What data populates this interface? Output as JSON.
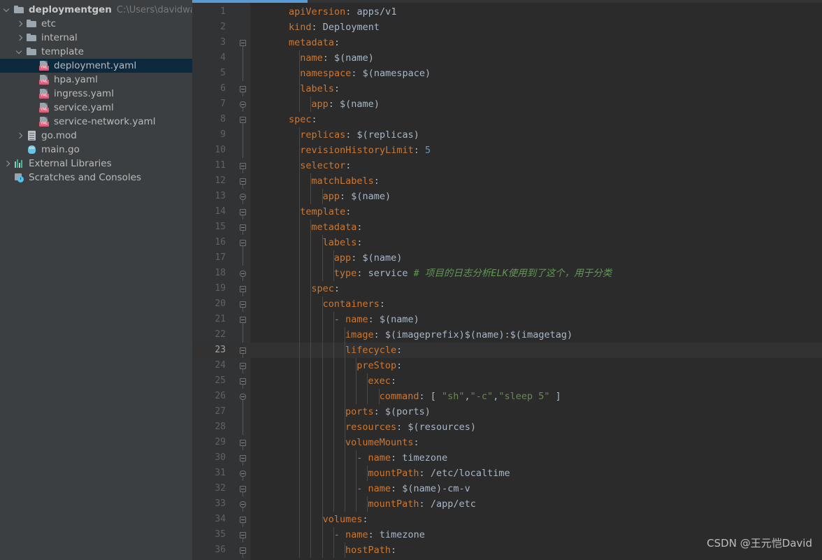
{
  "project": {
    "root": {
      "label": "deploymentgen",
      "path": "C:\\Users\\davidwang.SC",
      "icon": "folder-icon",
      "expanded": true
    },
    "items": [
      {
        "label": "etc",
        "icon": "folder-icon",
        "depth": 1,
        "chevron": "collapsed",
        "selected": false
      },
      {
        "label": "internal",
        "icon": "folder-icon",
        "depth": 1,
        "chevron": "collapsed",
        "selected": false
      },
      {
        "label": "template",
        "icon": "folder-icon",
        "depth": 1,
        "chevron": "expanded",
        "selected": false
      },
      {
        "label": "deployment.yaml",
        "icon": "yaml-file-icon",
        "depth": 2,
        "chevron": "none",
        "selected": true
      },
      {
        "label": "hpa.yaml",
        "icon": "yaml-file-icon",
        "depth": 2,
        "chevron": "none",
        "selected": false
      },
      {
        "label": "ingress.yaml",
        "icon": "yaml-file-icon",
        "depth": 2,
        "chevron": "none",
        "selected": false
      },
      {
        "label": "service.yaml",
        "icon": "yaml-file-icon",
        "depth": 2,
        "chevron": "none",
        "selected": false
      },
      {
        "label": "service-network.yaml",
        "icon": "yaml-file-icon",
        "depth": 2,
        "chevron": "none",
        "selected": false
      },
      {
        "label": "go.mod",
        "icon": "mod-file-icon",
        "depth": 1,
        "chevron": "collapsed",
        "selected": false
      },
      {
        "label": "main.go",
        "icon": "go-file-icon",
        "depth": 1,
        "chevron": "none",
        "selected": false
      },
      {
        "label": "External Libraries",
        "icon": "libraries-icon",
        "depth": 0,
        "chevron": "collapsed",
        "selected": false
      },
      {
        "label": "Scratches and Consoles",
        "icon": "scratches-icon",
        "depth": 0,
        "chevron": "none",
        "selected": false
      }
    ],
    "yaml_badge": "YML"
  },
  "editor": {
    "progress_percent": 18,
    "current_line": 23,
    "first_line": 1,
    "last_line": 36,
    "code_lines": [
      {
        "n": 1,
        "indent": 0,
        "fold": "none",
        "tokens": [
          {
            "t": "apiVersion",
            "c": "k"
          },
          {
            "t": ": ",
            "c": "p"
          },
          {
            "t": "apps/v1",
            "c": "v"
          }
        ]
      },
      {
        "n": 2,
        "indent": 0,
        "fold": "none",
        "tokens": [
          {
            "t": "kind",
            "c": "k"
          },
          {
            "t": ": ",
            "c": "p"
          },
          {
            "t": "Deployment",
            "c": "v"
          }
        ]
      },
      {
        "n": 3,
        "indent": 0,
        "fold": "open",
        "tokens": [
          {
            "t": "metadata",
            "c": "k"
          },
          {
            "t": ":",
            "c": "p"
          }
        ]
      },
      {
        "n": 4,
        "indent": 1,
        "fold": "none",
        "tokens": [
          {
            "t": "name",
            "c": "k"
          },
          {
            "t": ": ",
            "c": "p"
          },
          {
            "t": "$(name)",
            "c": "v"
          }
        ]
      },
      {
        "n": 5,
        "indent": 1,
        "fold": "none",
        "tokens": [
          {
            "t": "namespace",
            "c": "k"
          },
          {
            "t": ": ",
            "c": "p"
          },
          {
            "t": "$(namespace)",
            "c": "v"
          }
        ]
      },
      {
        "n": 6,
        "indent": 1,
        "fold": "open",
        "tokens": [
          {
            "t": "labels",
            "c": "k"
          },
          {
            "t": ":",
            "c": "p"
          }
        ]
      },
      {
        "n": 7,
        "indent": 2,
        "fold": "leaf",
        "tokens": [
          {
            "t": "app",
            "c": "k"
          },
          {
            "t": ": ",
            "c": "p"
          },
          {
            "t": "$(name)",
            "c": "v"
          }
        ]
      },
      {
        "n": 8,
        "indent": 0,
        "fold": "open",
        "tokens": [
          {
            "t": "spec",
            "c": "k"
          },
          {
            "t": ":",
            "c": "p"
          }
        ]
      },
      {
        "n": 9,
        "indent": 1,
        "fold": "none",
        "tokens": [
          {
            "t": "replicas",
            "c": "k"
          },
          {
            "t": ": ",
            "c": "p"
          },
          {
            "t": "$(replicas)",
            "c": "v"
          }
        ]
      },
      {
        "n": 10,
        "indent": 1,
        "fold": "none",
        "tokens": [
          {
            "t": "revisionHistoryLimit",
            "c": "k"
          },
          {
            "t": ": ",
            "c": "p"
          },
          {
            "t": "5",
            "c": "num"
          }
        ]
      },
      {
        "n": 11,
        "indent": 1,
        "fold": "open",
        "tokens": [
          {
            "t": "selector",
            "c": "k"
          },
          {
            "t": ":",
            "c": "p"
          }
        ]
      },
      {
        "n": 12,
        "indent": 2,
        "fold": "open",
        "tokens": [
          {
            "t": "matchLabels",
            "c": "k"
          },
          {
            "t": ":",
            "c": "p"
          }
        ]
      },
      {
        "n": 13,
        "indent": 3,
        "fold": "leaf",
        "tokens": [
          {
            "t": "app",
            "c": "k"
          },
          {
            "t": ": ",
            "c": "p"
          },
          {
            "t": "$(name)",
            "c": "v"
          }
        ]
      },
      {
        "n": 14,
        "indent": 1,
        "fold": "open",
        "tokens": [
          {
            "t": "template",
            "c": "k"
          },
          {
            "t": ":",
            "c": "p"
          }
        ]
      },
      {
        "n": 15,
        "indent": 2,
        "fold": "open",
        "tokens": [
          {
            "t": "metadata",
            "c": "k"
          },
          {
            "t": ":",
            "c": "p"
          }
        ]
      },
      {
        "n": 16,
        "indent": 3,
        "fold": "open",
        "tokens": [
          {
            "t": "labels",
            "c": "k"
          },
          {
            "t": ":",
            "c": "p"
          }
        ]
      },
      {
        "n": 17,
        "indent": 4,
        "fold": "none",
        "tokens": [
          {
            "t": "app",
            "c": "k"
          },
          {
            "t": ": ",
            "c": "p"
          },
          {
            "t": "$(name)",
            "c": "v"
          }
        ]
      },
      {
        "n": 18,
        "indent": 4,
        "fold": "leaf",
        "tokens": [
          {
            "t": "type",
            "c": "k"
          },
          {
            "t": ": ",
            "c": "p"
          },
          {
            "t": "service",
            "c": "v"
          },
          {
            "t": " ",
            "c": "p"
          },
          {
            "t": "# 项目的日志分析ELK使用到了这个，用于分类",
            "c": "cm"
          }
        ]
      },
      {
        "n": 19,
        "indent": 2,
        "fold": "open",
        "tokens": [
          {
            "t": "spec",
            "c": "k"
          },
          {
            "t": ":",
            "c": "p"
          }
        ]
      },
      {
        "n": 20,
        "indent": 3,
        "fold": "open",
        "tokens": [
          {
            "t": "containers",
            "c": "k"
          },
          {
            "t": ":",
            "c": "p"
          }
        ]
      },
      {
        "n": 21,
        "indent": 4,
        "fold": "open",
        "tokens": [
          {
            "t": "- ",
            "c": "da"
          },
          {
            "t": "name",
            "c": "k"
          },
          {
            "t": ": ",
            "c": "p"
          },
          {
            "t": "$(name)",
            "c": "v"
          }
        ]
      },
      {
        "n": 22,
        "indent": 5,
        "fold": "none",
        "tokens": [
          {
            "t": "image",
            "c": "k"
          },
          {
            "t": ": ",
            "c": "p"
          },
          {
            "t": "$(imageprefix)$(name):$(imagetag)",
            "c": "v"
          }
        ]
      },
      {
        "n": 23,
        "indent": 5,
        "fold": "open",
        "tokens": [
          {
            "t": "lifecycle",
            "c": "k"
          },
          {
            "t": ":",
            "c": "p"
          }
        ]
      },
      {
        "n": 24,
        "indent": 6,
        "fold": "open",
        "tokens": [
          {
            "t": "preStop",
            "c": "k"
          },
          {
            "t": ":",
            "c": "p"
          }
        ]
      },
      {
        "n": 25,
        "indent": 7,
        "fold": "open",
        "tokens": [
          {
            "t": "exec",
            "c": "k"
          },
          {
            "t": ":",
            "c": "p"
          }
        ]
      },
      {
        "n": 26,
        "indent": 8,
        "fold": "leaf",
        "tokens": [
          {
            "t": "command",
            "c": "k"
          },
          {
            "t": ": [ ",
            "c": "p"
          },
          {
            "t": "\"sh\"",
            "c": "str"
          },
          {
            "t": ",",
            "c": "p"
          },
          {
            "t": "\"-c\"",
            "c": "str"
          },
          {
            "t": ",",
            "c": "p"
          },
          {
            "t": "\"sleep 5\"",
            "c": "str"
          },
          {
            "t": " ]",
            "c": "p"
          }
        ]
      },
      {
        "n": 27,
        "indent": 5,
        "fold": "none",
        "tokens": [
          {
            "t": "ports",
            "c": "k"
          },
          {
            "t": ": ",
            "c": "p"
          },
          {
            "t": "$(ports)",
            "c": "v"
          }
        ]
      },
      {
        "n": 28,
        "indent": 5,
        "fold": "none",
        "tokens": [
          {
            "t": "resources",
            "c": "k"
          },
          {
            "t": ": ",
            "c": "p"
          },
          {
            "t": "$(resources)",
            "c": "v"
          }
        ]
      },
      {
        "n": 29,
        "indent": 5,
        "fold": "open",
        "tokens": [
          {
            "t": "volumeMounts",
            "c": "k"
          },
          {
            "t": ":",
            "c": "p"
          }
        ]
      },
      {
        "n": 30,
        "indent": 6,
        "fold": "open",
        "tokens": [
          {
            "t": "- ",
            "c": "da"
          },
          {
            "t": "name",
            "c": "k"
          },
          {
            "t": ": ",
            "c": "p"
          },
          {
            "t": "timezone",
            "c": "v"
          }
        ]
      },
      {
        "n": 31,
        "indent": 7,
        "fold": "leaf",
        "tokens": [
          {
            "t": "mountPath",
            "c": "k"
          },
          {
            "t": ": ",
            "c": "p"
          },
          {
            "t": "/etc/localtime",
            "c": "v"
          }
        ]
      },
      {
        "n": 32,
        "indent": 6,
        "fold": "open",
        "tokens": [
          {
            "t": "- ",
            "c": "da"
          },
          {
            "t": "name",
            "c": "k"
          },
          {
            "t": ": ",
            "c": "p"
          },
          {
            "t": "$(name)-cm-v",
            "c": "v"
          }
        ]
      },
      {
        "n": 33,
        "indent": 7,
        "fold": "leaf",
        "tokens": [
          {
            "t": "mountPath",
            "c": "k"
          },
          {
            "t": ": ",
            "c": "p"
          },
          {
            "t": "/app/etc",
            "c": "v"
          }
        ]
      },
      {
        "n": 34,
        "indent": 3,
        "fold": "open",
        "tokens": [
          {
            "t": "volumes",
            "c": "k"
          },
          {
            "t": ":",
            "c": "p"
          }
        ]
      },
      {
        "n": 35,
        "indent": 4,
        "fold": "open",
        "tokens": [
          {
            "t": "- ",
            "c": "da"
          },
          {
            "t": "name",
            "c": "k"
          },
          {
            "t": ": ",
            "c": "p"
          },
          {
            "t": "timezone",
            "c": "v"
          }
        ]
      },
      {
        "n": 36,
        "indent": 5,
        "fold": "open",
        "tokens": [
          {
            "t": "hostPath",
            "c": "k"
          },
          {
            "t": ":",
            "c": "p"
          }
        ]
      }
    ]
  },
  "watermark": {
    "text": "CSDN @王元恺David"
  },
  "colors": {
    "sidebar_bg": "#3c3f41",
    "editor_bg": "#2b2b2b",
    "gutter_bg": "#313335",
    "selection_bg": "#0d293e",
    "current_line_bg": "#323232",
    "key": "#cc7832",
    "value": "#a9b7c6",
    "number": "#6897bb",
    "string": "#6a8759",
    "comment": "#629755",
    "progress": "#5a9bd5"
  }
}
